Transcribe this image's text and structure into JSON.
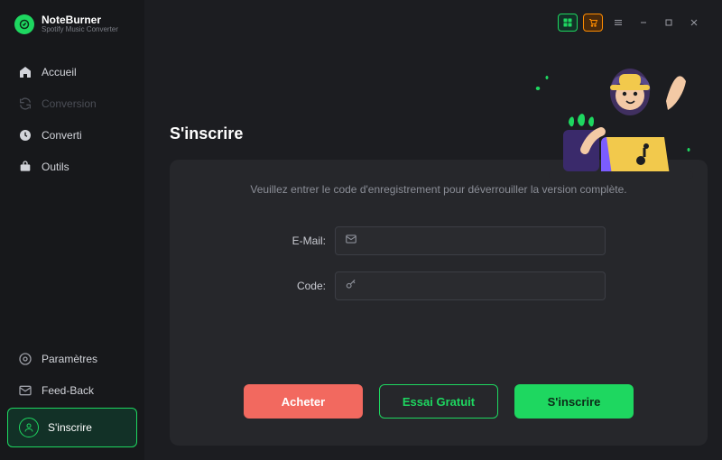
{
  "app": {
    "name": "NoteBurner",
    "subtitle": "Spotify Music Converter"
  },
  "sidebar": {
    "items": [
      {
        "label": "Accueil"
      },
      {
        "label": "Conversion"
      },
      {
        "label": "Converti"
      },
      {
        "label": "Outils"
      }
    ],
    "bottom": [
      {
        "label": "Paramètres"
      },
      {
        "label": "Feed-Back"
      }
    ],
    "active": {
      "label": "S'inscrire"
    }
  },
  "page": {
    "title": "S'inscrire",
    "instruction": "Veuillez entrer le code d'enregistrement pour déverrouiller la version complète.",
    "fields": {
      "email_label": "E-Mail:",
      "code_label": "Code:"
    },
    "buttons": {
      "buy": "Acheter",
      "trial": "Essai Gratuit",
      "signup": "S'inscrire"
    }
  },
  "colors": {
    "accent": "#1ed760",
    "danger": "#f2695f",
    "orange": "#ff8c00"
  }
}
